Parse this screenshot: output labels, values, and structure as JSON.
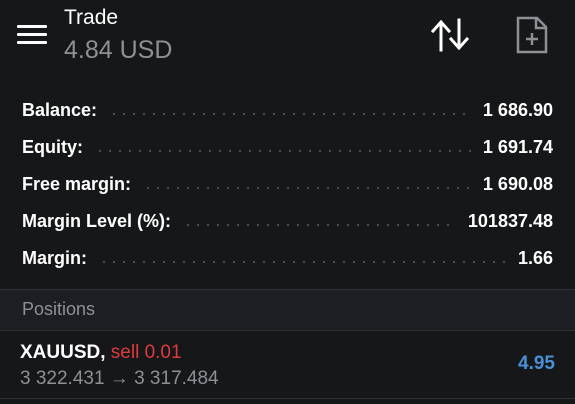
{
  "header": {
    "title": "Trade",
    "subtitle": "4.84 USD",
    "icons": {
      "menu": "menu-icon",
      "sort": "sort-icon",
      "new_order": "new-document-icon"
    }
  },
  "summary": {
    "balance": {
      "label": "Balance:",
      "value": "1 686.90"
    },
    "equity": {
      "label": "Equity:",
      "value": "1 691.74"
    },
    "free_margin": {
      "label": "Free margin:",
      "value": "1 690.08"
    },
    "margin_level": {
      "label": "Margin Level (%):",
      "value": "101837.48"
    },
    "margin": {
      "label": "Margin:",
      "value": "1.66"
    }
  },
  "positions": {
    "title": "Positions",
    "items": [
      {
        "symbol": "XAUUSD,",
        "side": "sell 0.01",
        "prices": "3 322.431 → 3 317.484",
        "profit": "4.95"
      }
    ]
  },
  "colors": {
    "background": "#151719",
    "sell": "#e0393e",
    "profit": "#4b8fd6",
    "muted": "#8d9095"
  }
}
